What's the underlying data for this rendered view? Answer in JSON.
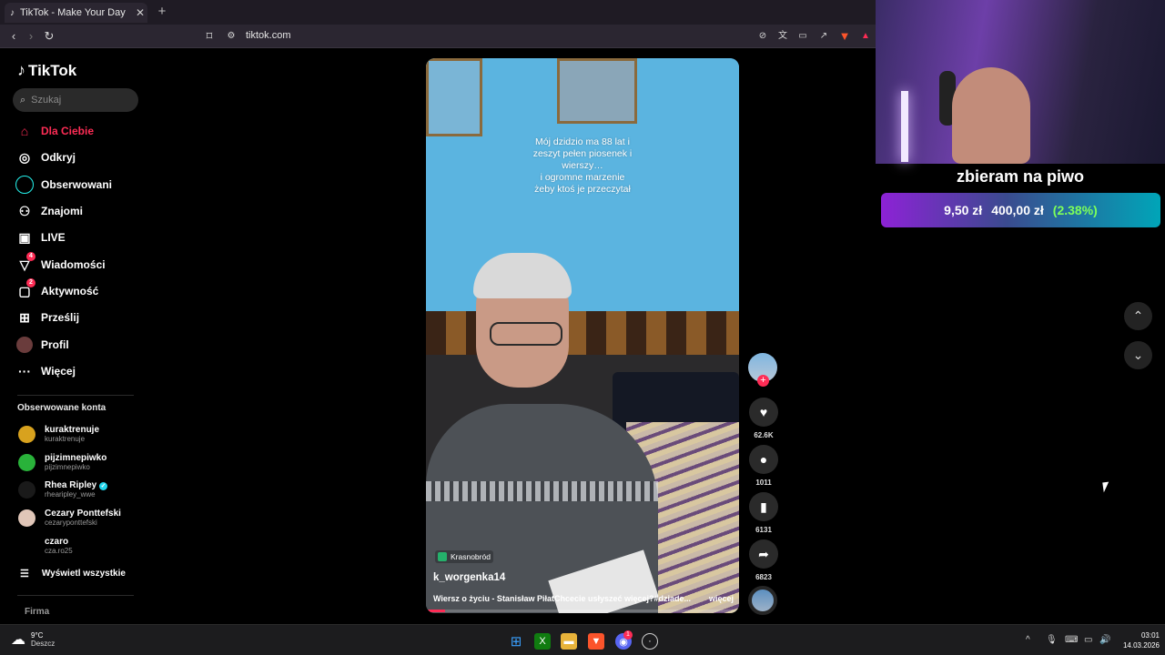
{
  "browser": {
    "tab_title": "TikTok - Make Your Day",
    "tab_close": "✕",
    "new_tab": "+",
    "url": "tiktok.com",
    "brave_badge": "9"
  },
  "sidebar": {
    "logo": "TikTok",
    "search_placeholder": "Szukaj",
    "nav": [
      {
        "label": "Dla Ciebie",
        "active": true
      },
      {
        "label": "Odkryj"
      },
      {
        "label": "Obserwowani"
      },
      {
        "label": "Znajomi"
      },
      {
        "label": "LIVE"
      },
      {
        "label": "Wiadomości",
        "badge": "4"
      },
      {
        "label": "Aktywność",
        "badge": "2"
      },
      {
        "label": "Prześlij"
      },
      {
        "label": "Profil"
      },
      {
        "label": "Więcej"
      }
    ],
    "followed_title": "Obserwowane konta",
    "accounts": [
      {
        "name": "kuraktrenuje",
        "handle": "kuraktrenuje"
      },
      {
        "name": "pijzimnepiwko",
        "handle": "pijzimnepiwko"
      },
      {
        "name": "Rhea Ripley",
        "handle": "rhearipley_wwe",
        "verified": true
      },
      {
        "name": "Cezary Ponttefski",
        "handle": "cezaryponttefski"
      },
      {
        "name": "czaro",
        "handle": "cza.ro25"
      }
    ],
    "show_all": "Wyświetl wszystkie",
    "company": "Firma"
  },
  "video": {
    "caption": "Mój dzidzio ma 88 lat i\nzeszyt pełen piosenek i\nwierszy…\ni ogromne marzenie\nżeby ktoś je przeczytał",
    "location": "Krasnobród",
    "author": "k_worgenka14",
    "description": "Wiersz o życiu - Stanisław PiłatChcecie usłyszeć więcej?#dziade...",
    "more": "więcej",
    "progress": 0.06
  },
  "actions": {
    "likes": "62.6K",
    "comments": "1011",
    "saves": "6131",
    "shares": "6823"
  },
  "stream": {
    "goal_title": "zbieram na piwo",
    "goal_current": "9,50 zł",
    "goal_target": "400,00 zł",
    "goal_percent": "(2.38%)"
  },
  "taskbar": {
    "temp": "9°C",
    "weather": "Deszcz",
    "discord_badge": "1",
    "time": "03:01",
    "date": "14.03.2026"
  },
  "colors": {
    "accent": "#fe2c55",
    "goal_percent": "#7dff5a"
  }
}
